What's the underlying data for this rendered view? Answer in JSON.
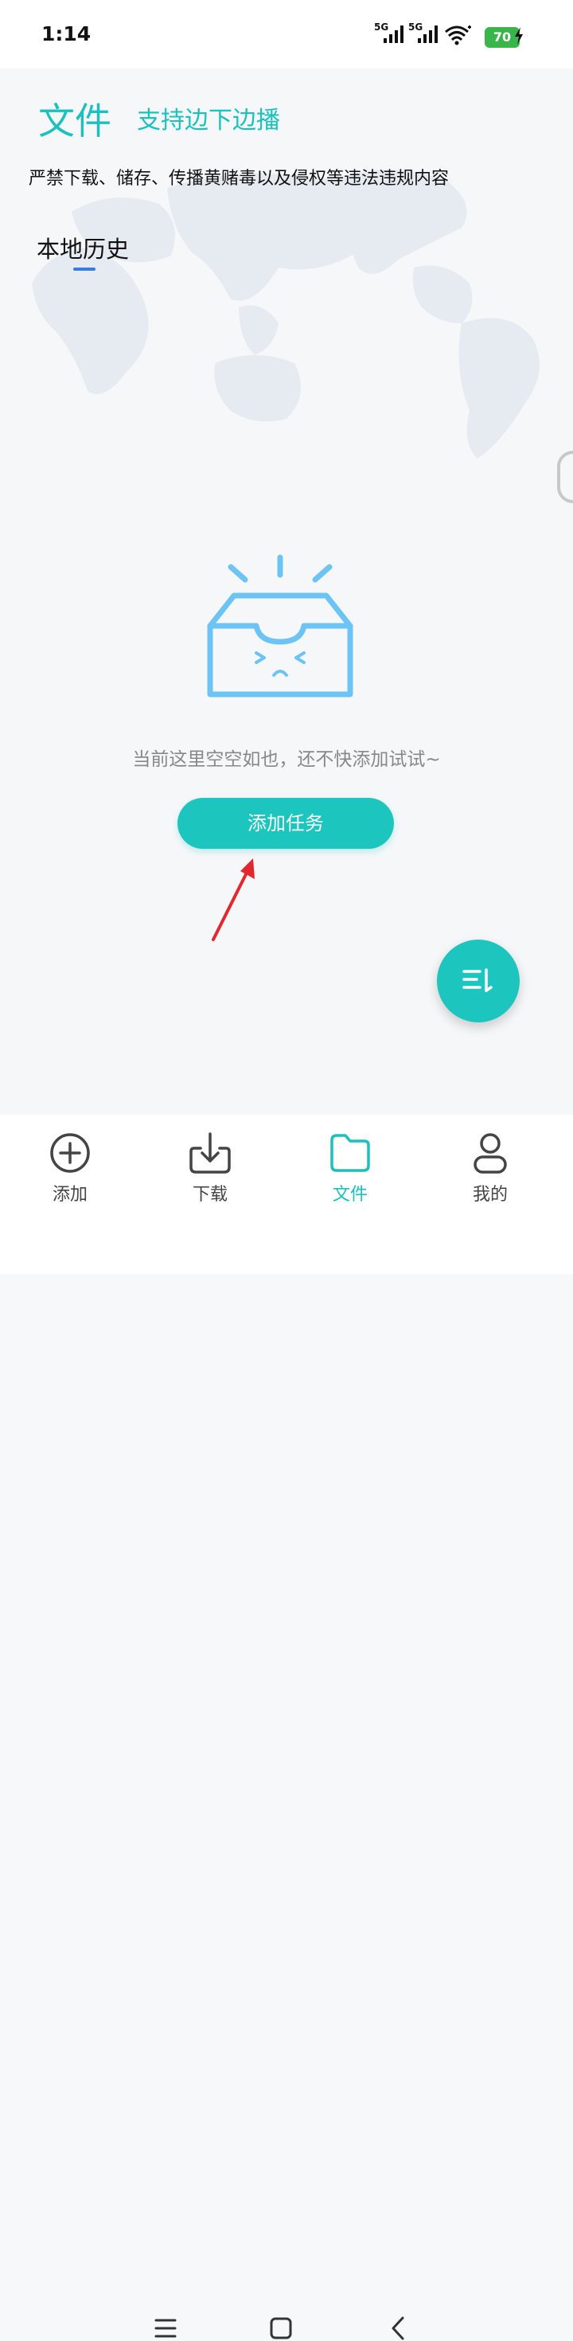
{
  "status_bar": {
    "time": "1:14",
    "network_1": "5G",
    "network_2": "5G",
    "battery": "70"
  },
  "header": {
    "title": "文件",
    "subtitle": "支持边下边播"
  },
  "notice": "严禁下载、储存、传播黄赌毒以及侵权等违法违规内容",
  "tabs": [
    {
      "label": "本地历史",
      "active": true
    }
  ],
  "empty_state": {
    "message": "当前这里空空如也，还不快添加试试~",
    "button_label": "添加任务"
  },
  "bottom_nav": [
    {
      "label": "添加",
      "icon": "plus-circle-icon",
      "active": false
    },
    {
      "label": "下载",
      "icon": "download-icon",
      "active": false
    },
    {
      "label": "文件",
      "icon": "folder-icon",
      "active": true
    },
    {
      "label": "我的",
      "icon": "user-icon",
      "active": false
    }
  ],
  "colors": {
    "accent": "#1cc6bf",
    "tab_indicator": "#3a7be0",
    "illustration": "#6cc4f4",
    "annotation_arrow": "#e0282e"
  }
}
